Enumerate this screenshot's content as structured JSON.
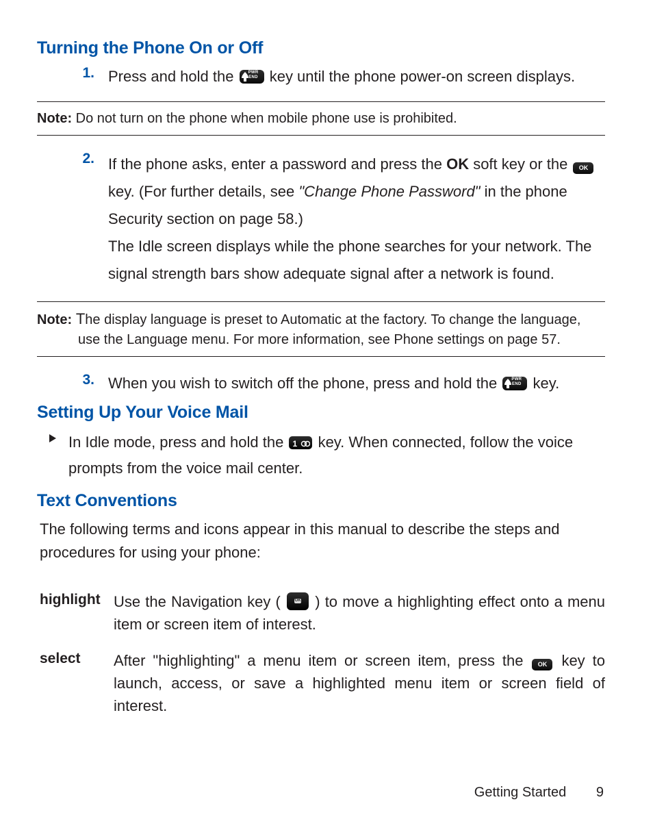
{
  "sections": {
    "power": {
      "heading": "Turning the Phone On or Off",
      "step1_num": "1.",
      "step1_a": "Press and hold the ",
      "step1_b": " key until the phone power-on screen displays.",
      "step2_num": "2.",
      "step2_a": "If the phone asks, enter a password and press the ",
      "step2_ok": "OK",
      "step2_b": " soft key or the ",
      "step2_c": " key. (For further details, see ",
      "step2_ref": "\"Change Phone Password\"",
      "step2_d": " in the phone Security section on page 58.)",
      "step2_p2": "The Idle screen displays while the phone searches for your network. The signal strength bars show adequate signal after a network is found.",
      "step3_num": "3.",
      "step3_a": "When you wish to switch off the phone, press and hold the ",
      "step3_b": " key."
    },
    "voicemail": {
      "heading": "Setting Up Your Voice Mail",
      "bullet_a": "In Idle mode, press and hold the ",
      "bullet_b": " key. When connected, follow the voice prompts from the voice mail center."
    },
    "text_conv": {
      "heading": "Text Conventions",
      "intro": "The following terms and icons appear in this manual to describe the steps and procedures for using your phone:",
      "highlight_term": "highlight",
      "highlight_def_a": "Use the Navigation key ( ",
      "highlight_def_b": " ) to move a highlighting effect onto a menu item or screen item of interest.",
      "select_term": "select",
      "select_def_a": "After \"highlighting\" a menu item or screen item, press the ",
      "select_def_b": " key to launch, access, or save a highlighted menu item or screen field of interest."
    }
  },
  "notes": {
    "label": "Note:",
    "note1": " Do not turn on the phone when mobile phone use is prohibited.",
    "note2_a": " T",
    "note2_b": "he display language is preset to Automatic at the factory. To change the language, use the Language menu. For more information, see Phone settings on page 57."
  },
  "icons": {
    "end_label": "PWR\nEND",
    "ok_label": "OK",
    "nav_inner": "OK"
  },
  "footer": {
    "section": "Getting Started",
    "page": "9"
  }
}
